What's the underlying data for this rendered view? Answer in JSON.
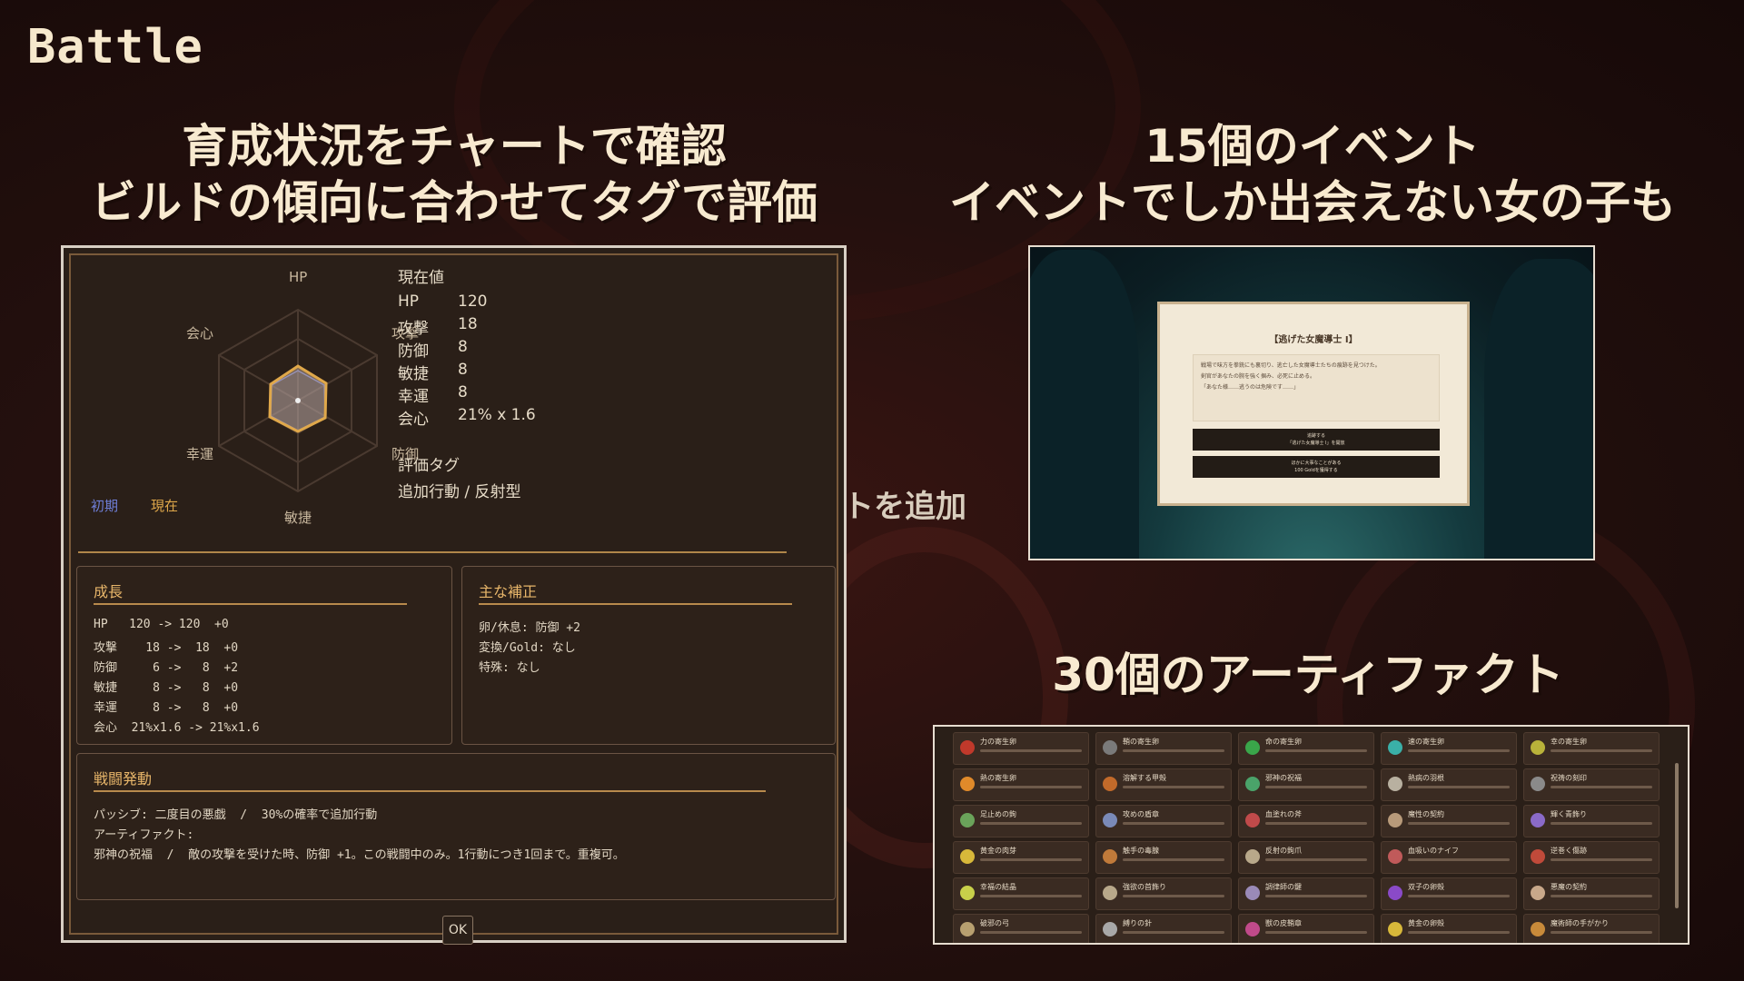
{
  "screen_title": "Battle",
  "left_heading": {
    "line1": "育成状況をチャートで確認",
    "line2": "ビルドの傾向に合わせてタグで評価"
  },
  "right_heading": {
    "line1": "15個のイベント",
    "line2": "イベントでしか出会えない女の子も"
  },
  "artifact_heading": "30個のアーティファクト",
  "background_peek": "トを追加",
  "status_panel": {
    "radar": {
      "labels": [
        "HP",
        "攻撃",
        "防御",
        "敏捷",
        "幸運",
        "会心"
      ],
      "legend_initial": "初期",
      "legend_current": "現在",
      "colors": {
        "current": "#e0a84a",
        "initial": "#6f7fd8"
      }
    },
    "current_values": {
      "heading": "現在値",
      "rows": [
        {
          "key": "HP",
          "value": "120"
        },
        {
          "key": "攻撃",
          "value": "18"
        },
        {
          "key": "防御",
          "value": "8"
        },
        {
          "key": "敏捷",
          "value": "8"
        },
        {
          "key": "幸運",
          "value": "8"
        },
        {
          "key": "会心",
          "value": "21% x 1.6"
        }
      ]
    },
    "tags": {
      "heading": "評価タグ",
      "value": "追加行動 / 反射型"
    },
    "growth": {
      "title": "成長",
      "lines": [
        "HP   120 -> 120  +0",
        "攻撃    18 ->  18  +0",
        "防御     6 ->   8  +2",
        "敏捷     8 ->   8  +0",
        "幸運     8 ->   8  +0",
        "会心  21%x1.6 -> 21%x1.6"
      ]
    },
    "corrections": {
      "title": "主な補正",
      "lines": [
        "卵/休息: 防御 +2",
        "変換/Gold: なし",
        "特殊: なし"
      ]
    },
    "battle_effects": {
      "title": "戦闘発動",
      "lines": [
        "パッシブ: 二度目の悪戯  /  30%の確率で追加行動",
        "アーティファクト:",
        "邪神の祝福  /  敵の攻撃を受けた時、防御 +1。この戦闘中のみ。1行動につき1回まで。重複可。"
      ]
    },
    "ok_label": "OK"
  },
  "event_dialog": {
    "title": "【逃げた女魔導士 Ⅰ】",
    "body": [
      "戦場で味方を拳銃にも裏切り、逃亡した女魔導士たちの痕跡を見つけた。",
      "剣官があなたの腕を強く掴み、必死に止める。",
      "「あなた様……逃うのは危険です……」"
    ],
    "option1": [
      "追跡する",
      "「逃げた女魔導士 Ⅰ」を開放"
    ],
    "option2": [
      "ほかに大事なことがある",
      "100 Goldを獲得する"
    ]
  },
  "artifacts": [
    {
      "name": "力の寄生卵",
      "color": "#c0392b"
    },
    {
      "name": "鞘の寄生卵",
      "color": "#7a7a7a"
    },
    {
      "name": "命の寄生卵",
      "color": "#3aa64a"
    },
    {
      "name": "速の寄生卵",
      "color": "#3ab0a8"
    },
    {
      "name": "幸の寄生卵",
      "color": "#b9b23a"
    },
    {
      "name": "熱の寄生卵",
      "color": "#e08a2a"
    },
    {
      "name": "溶解する甲殻",
      "color": "#c26a2a"
    },
    {
      "name": "邪神の祝福",
      "color": "#4aa36a"
    },
    {
      "name": "熱病の羽根",
      "color": "#b8b0a0"
    },
    {
      "name": "祝祷の刻印",
      "color": "#8a8a8a"
    },
    {
      "name": "足止めの鉤",
      "color": "#6aa35a"
    },
    {
      "name": "攻めの盾章",
      "color": "#7a8ab8"
    },
    {
      "name": "血塗れの斧",
      "color": "#c04a4a"
    },
    {
      "name": "魔性の契約",
      "color": "#b89a7a"
    },
    {
      "name": "輝く青飾り",
      "color": "#8a6ac8"
    },
    {
      "name": "黄金の肉芽",
      "color": "#d8b83a"
    },
    {
      "name": "触手の毒腺",
      "color": "#c07a3a"
    },
    {
      "name": "反射の鉤爪",
      "color": "#b8a88a"
    },
    {
      "name": "血吸いのナイフ",
      "color": "#c05a5a"
    },
    {
      "name": "逆巻く傷跡",
      "color": "#c04a3a"
    },
    {
      "name": "幸福の結晶",
      "color": "#c8d04a"
    },
    {
      "name": "強欲の首飾り",
      "color": "#b8a88a"
    },
    {
      "name": "調律師の鍵",
      "color": "#9a8ab8"
    },
    {
      "name": "双子の卵殻",
      "color": "#8a4ac8"
    },
    {
      "name": "悪魔の契約",
      "color": "#c8a88a"
    },
    {
      "name": "破邪の弓",
      "color": "#b8a070"
    },
    {
      "name": "縛りの針",
      "color": "#a8a8a8"
    },
    {
      "name": "獣の皮鞘章",
      "color": "#c04a8a"
    },
    {
      "name": "黄金の卵殻",
      "color": "#d8b83a"
    },
    {
      "name": "魔術師の手がかり",
      "color": "#c88a3a"
    }
  ]
}
